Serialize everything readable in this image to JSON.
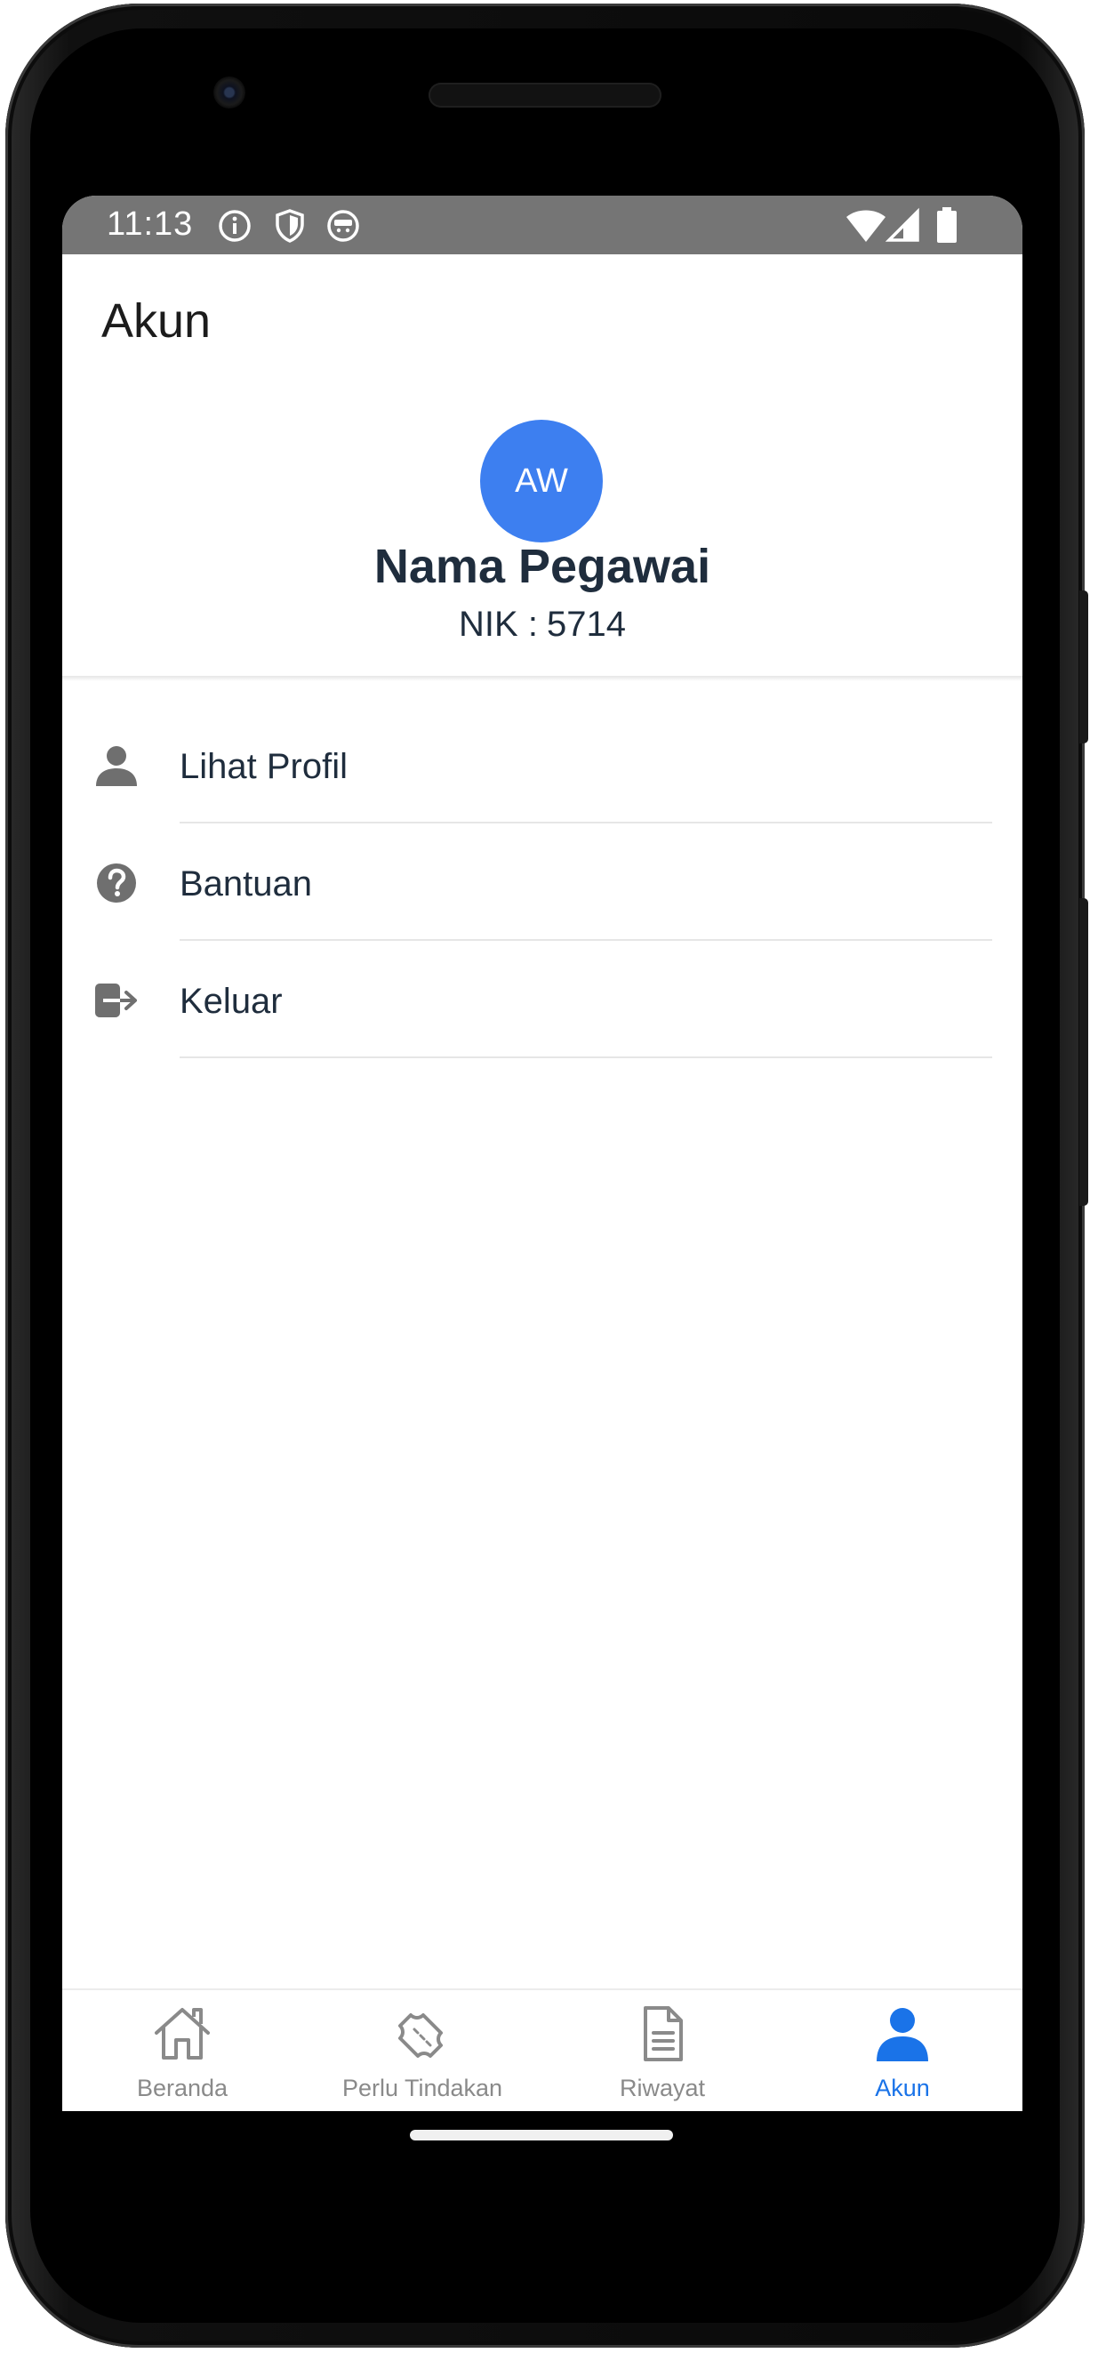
{
  "status_bar": {
    "time": "11:13",
    "icons": [
      "info-icon",
      "shield-icon",
      "app-face-icon",
      "wifi-icon",
      "signal-icon",
      "battery-icon"
    ],
    "background": "#757575"
  },
  "header": {
    "title": "Akun"
  },
  "profile": {
    "initials": "AW",
    "name": "Nama Pegawai",
    "nik_label": "NIK :",
    "nik_value": "5714",
    "avatar_color": "#3d7ff0"
  },
  "menu": {
    "items": [
      {
        "label": "Lihat Profil",
        "icon": "person-icon"
      },
      {
        "label": "Bantuan",
        "icon": "help-icon"
      },
      {
        "label": "Keluar",
        "icon": "logout-icon"
      }
    ]
  },
  "bottom_nav": {
    "items": [
      {
        "label": "Beranda",
        "icon": "home-icon",
        "active": false
      },
      {
        "label": "Perlu Tindakan",
        "icon": "ticket-icon",
        "active": false
      },
      {
        "label": "Riwayat",
        "icon": "document-icon",
        "active": false
      },
      {
        "label": "Akun",
        "icon": "person-icon",
        "active": true
      }
    ],
    "active_color": "#1a73e8",
    "inactive_color": "#8a8a8a"
  }
}
